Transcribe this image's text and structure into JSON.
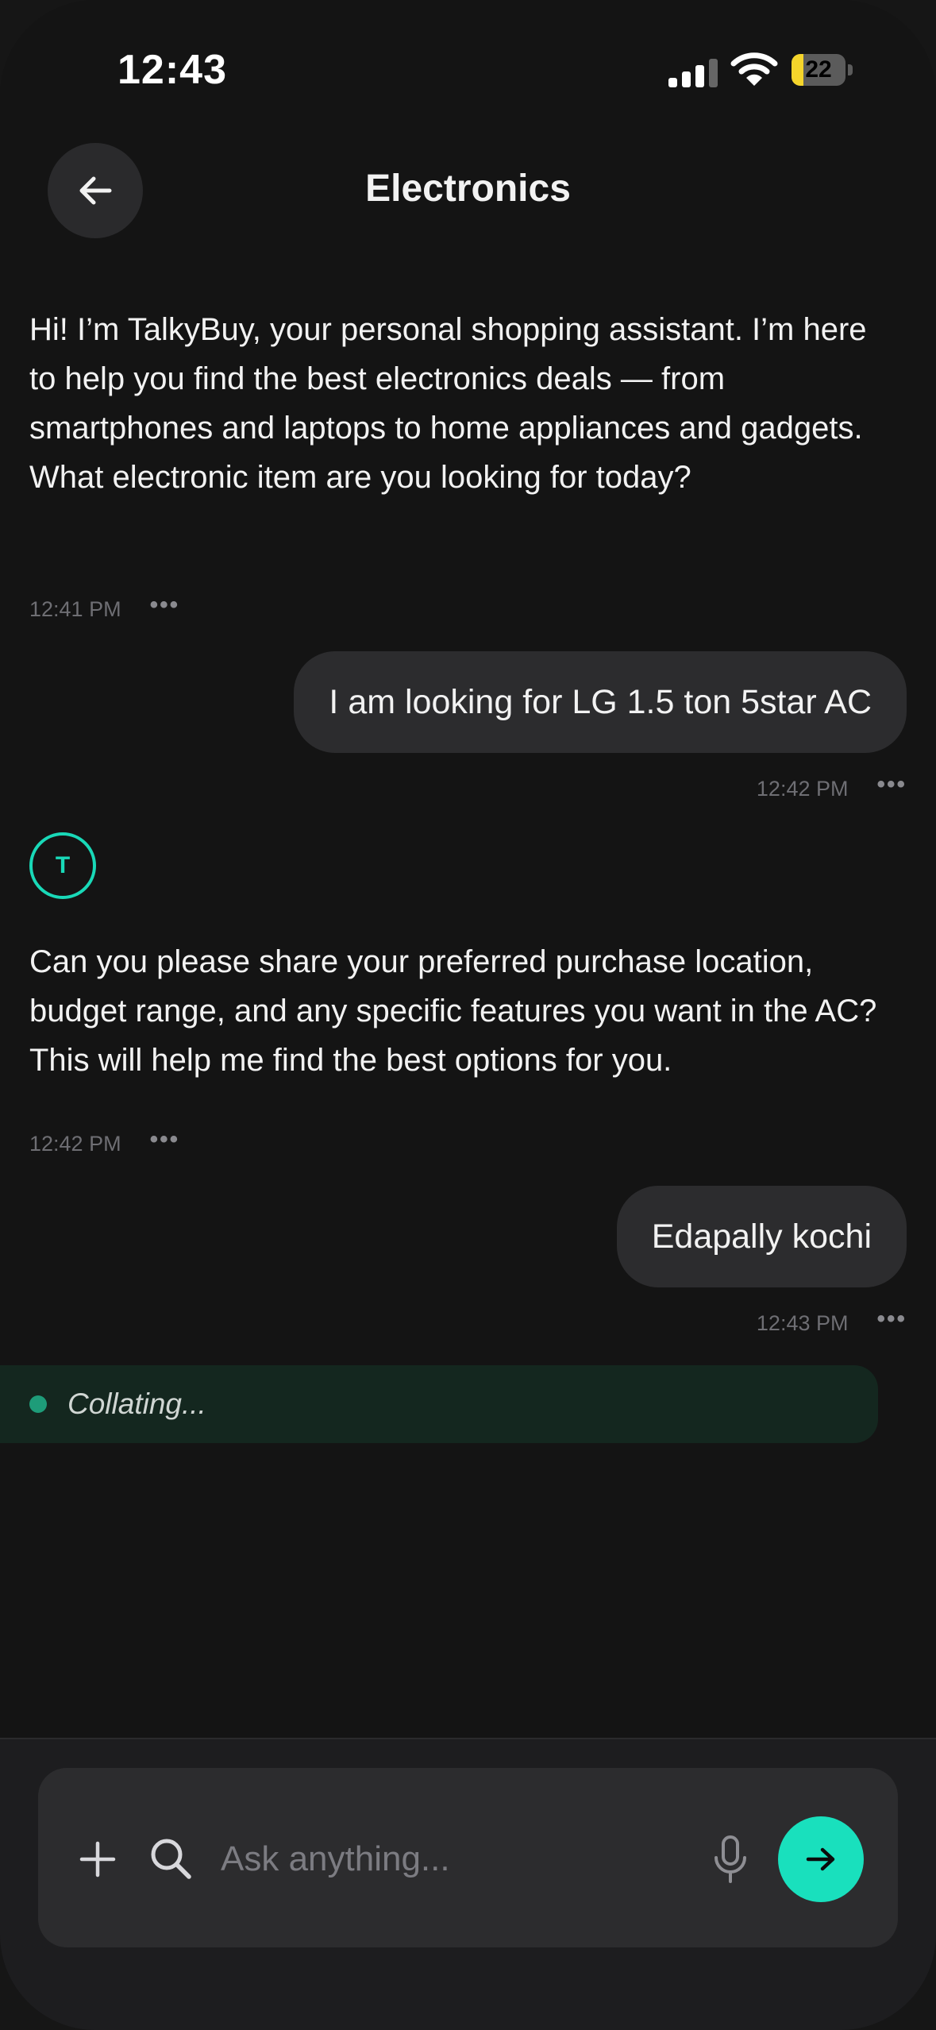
{
  "status_bar": {
    "time": "12:43",
    "battery": "22",
    "battery_level": 0.22
  },
  "header": {
    "title": "Electronics"
  },
  "messages": [
    {
      "role": "assistant",
      "text": "Hi! I’m TalkyBuy, your personal shopping assistant. I’m here to help you find the best electronics deals — from smartphones and laptops to home appliances and gadgets. What electronic item are you looking for today?",
      "time": "12:41 PM"
    },
    {
      "role": "user",
      "text": "I am looking for LG 1.5 ton 5star AC",
      "time": "12:42 PM"
    },
    {
      "role": "assistant",
      "avatar": "T",
      "text": "Can you please share your preferred purchase location, budget range, and any specific features you want in the AC? This will help me find the best options for you.",
      "time": "12:42 PM"
    },
    {
      "role": "user",
      "text": "Edapally kochi",
      "time": "12:43 PM"
    }
  ],
  "status_indicator": {
    "label": "Collating..."
  },
  "composer": {
    "placeholder": "Ask anything..."
  },
  "colors": {
    "accent": "#19e0bd",
    "background": "#141414",
    "bubble": "#2c2c2e",
    "collating_bg": "#14271f"
  },
  "icons": {
    "back": "arrow-left-icon",
    "plus": "plus-icon",
    "search": "search-icon",
    "mic": "microphone-icon",
    "send": "arrow-right-icon",
    "more": "more-dots-icon"
  }
}
